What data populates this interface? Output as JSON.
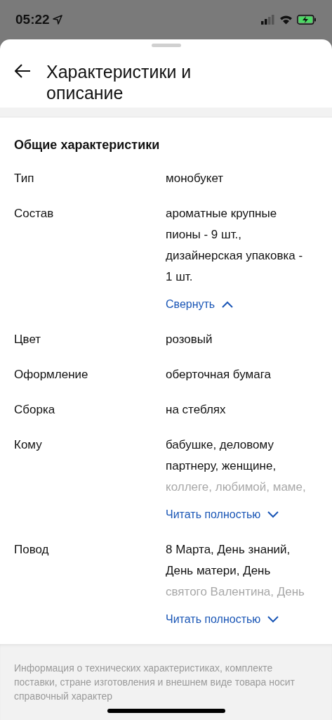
{
  "status_bar": {
    "time": "05:22"
  },
  "header": {
    "title": "Характеристики и описание"
  },
  "section": {
    "title": "Общие характеристики",
    "rows": [
      {
        "label": "Тип",
        "value": "монобукет"
      },
      {
        "label": "Состав",
        "value": "ароматные крупные пионы - 9 шт., дизайнерская упаковка - 1 шт.",
        "toggle": {
          "label": "Свернуть",
          "expanded": true
        }
      },
      {
        "label": "Цвет",
        "value": "розовый"
      },
      {
        "label": "Оформление",
        "value": "оберточная бумага"
      },
      {
        "label": "Сборка",
        "value": "на стеблях"
      },
      {
        "label": "Кому",
        "value": "бабушке, деловому партнеру, женщине,",
        "faded_value": "коллеге, любимой, маме,",
        "toggle": {
          "label": "Читать полностью",
          "expanded": false
        }
      },
      {
        "label": "Повод",
        "value": "8 Марта, День знаний, День матери, День",
        "faded_value": "святого Валентина, День",
        "toggle": {
          "label": "Читать полностью",
          "expanded": false
        }
      }
    ]
  },
  "footer_note": "Информация о технических характеристиках, комплекте поставки, стране изготовления и внешнем виде товара носит справочный характер"
}
